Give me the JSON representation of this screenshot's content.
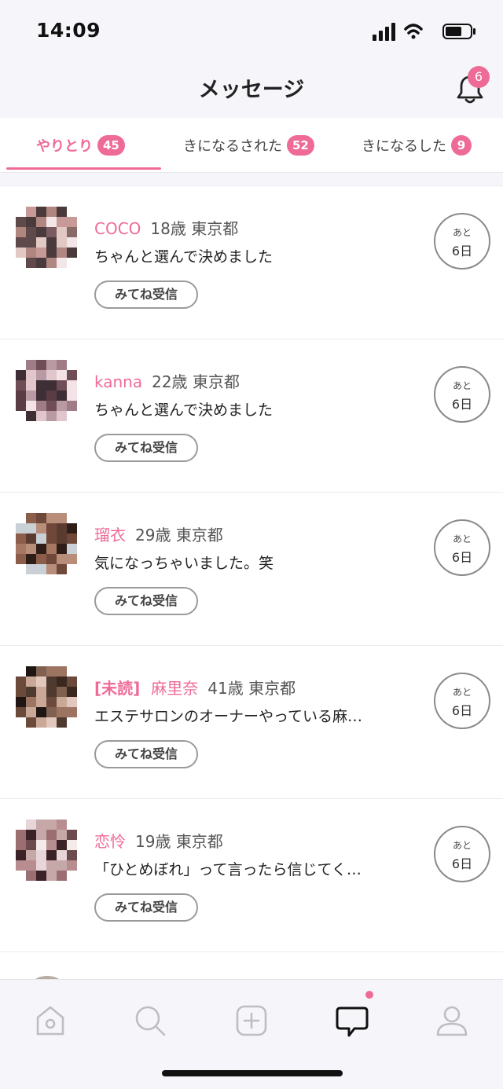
{
  "status_bar": {
    "time": "14:09"
  },
  "header": {
    "title": "メッセージ",
    "notification_count": "6"
  },
  "tabs": [
    {
      "label": "やりとり",
      "count": "45",
      "active": true
    },
    {
      "label": "きになるされた",
      "count": "52",
      "active": false
    },
    {
      "label": "きになるした",
      "count": "9",
      "active": false
    }
  ],
  "messages": [
    {
      "unread": "",
      "name": "COCO",
      "age": "18歳",
      "location": "東京都",
      "text": "ちゃんと選んで決めました",
      "button": "みてね受信",
      "timer_top": "あと",
      "timer_bottom": "6日"
    },
    {
      "unread": "",
      "name": "kanna",
      "age": "22歳",
      "location": "東京都",
      "text": "ちゃんと選んで決めました",
      "button": "みてね受信",
      "timer_top": "あと",
      "timer_bottom": "6日"
    },
    {
      "unread": "",
      "name": "瑠衣",
      "age": "29歳",
      "location": "東京都",
      "text": "気になっちゃいました。笑",
      "button": "みてね受信",
      "timer_top": "あと",
      "timer_bottom": "6日"
    },
    {
      "unread": "[未読]",
      "name": "麻里奈",
      "age": "41歳",
      "location": "東京都",
      "text": "エステサロンのオーナーやっている麻…",
      "button": "みてね受信",
      "timer_top": "あと",
      "timer_bottom": "6日"
    },
    {
      "unread": "",
      "name": "恋怜",
      "age": "19歳",
      "location": "東京都",
      "text": "「ひとめぼれ」って言ったら信じてく…",
      "button": "みてね受信",
      "timer_top": "あと",
      "timer_bottom": "6日"
    }
  ],
  "bottom_nav": [
    {
      "icon": "home-icon",
      "active": false
    },
    {
      "icon": "search-icon",
      "active": false
    },
    {
      "icon": "post-plus-icon",
      "active": false
    },
    {
      "icon": "message-icon",
      "active": true,
      "has_notification": true
    },
    {
      "icon": "profile-icon",
      "active": false
    }
  ],
  "colors": {
    "accent": "#ef6b97",
    "background": "#f6f6fa"
  }
}
